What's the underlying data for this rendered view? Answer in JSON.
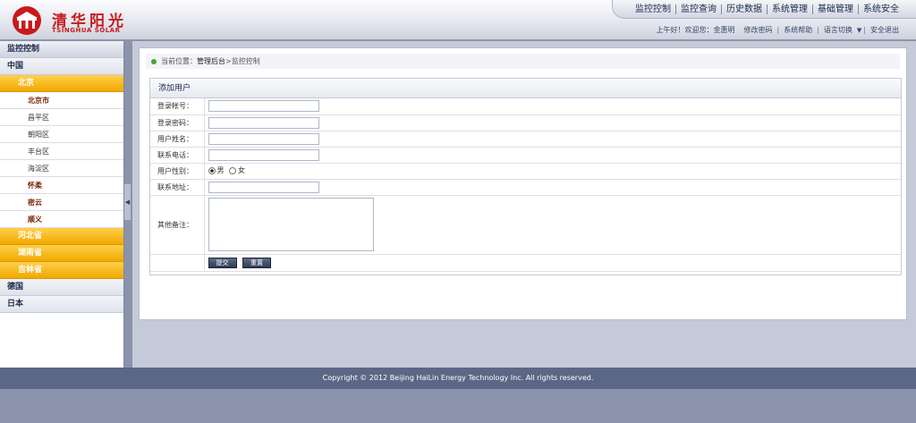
{
  "brand": {
    "name": "清华阳光",
    "sub": "TSINGHUA SOLAR"
  },
  "topnav": [
    "监控控制",
    "监控查询",
    "历史数据",
    "系统管理",
    "基础管理",
    "系统安全"
  ],
  "userbar": {
    "greeting": "上午好！欢迎您：金惠明",
    "change_pwd": "修改密码",
    "help": "系统帮助",
    "language": "语言切换",
    "logout": "安全退出"
  },
  "sidebar": {
    "header": "监控控制",
    "china": "中国",
    "beijing": "北京",
    "districts": [
      "北京市",
      "昌平区",
      "朝阳区",
      "丰台区",
      "海淀区",
      "怀柔",
      "密云",
      "顺义"
    ],
    "provinces": [
      "河北省",
      "湖南省",
      "吉林省"
    ],
    "germany": "德国",
    "japan": "日本"
  },
  "breadcrumb": {
    "prefix": "当前位置：",
    "home": "管理后台",
    "sep": " > ",
    "current": "监控控制"
  },
  "form": {
    "title": "添加用户",
    "account_label": "登录帐号：",
    "password_label": "登录密码：",
    "name_label": "用户姓名：",
    "phone_label": "联系电话：",
    "gender_label": "用户性别：",
    "male": "男",
    "female": "女",
    "address_label": "联系地址：",
    "notes_label": "其他备注：",
    "submit": "提交",
    "reset": "重置"
  },
  "footer": "Copyright © 2012 Beijing HaiLin Energy Technology Inc. All rights reserved."
}
